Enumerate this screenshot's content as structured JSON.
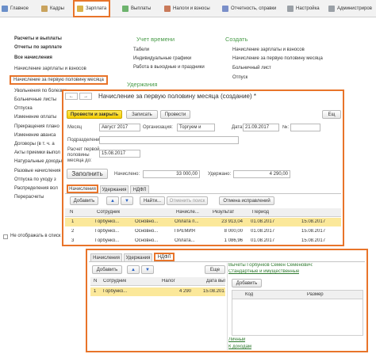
{
  "topbar": {
    "items": [
      "Главное",
      "Кадры",
      "Зарплата",
      "Выплаты",
      "Налоги и взносы",
      "Отчетность, справки",
      "Настройка",
      "Администриров"
    ],
    "icon_colors": [
      "#6a8fc9",
      "#c9a35d",
      "#d9b34a",
      "#6db36d",
      "#c97a5a",
      "#7a8fc9",
      "#9aa0a6",
      "#9aa0a6"
    ]
  },
  "bg": {
    "left_links": [
      "Расчеты и выплаты",
      "Отчеты по зарплате",
      "Все начисления",
      "Начисление зарплаты и взносов",
      "Начисление за первую половину месяца",
      "Увольнения по болезни",
      "Больничные листы",
      "Отпуска",
      "Изменение оплаты",
      "Прекращения плано",
      "Изменение аванса",
      "Договоры (в т. ч. а",
      "Акты приемки выпол",
      "Натуральные доходы",
      "Разовые начисления",
      "Отпуска по уходу з",
      "Распределения вол",
      "Перерасчеты"
    ],
    "accounting_title": "Учет времени",
    "accounting_links": [
      "Табели",
      "Индивидуальные графики",
      "Работа в выходные и праздники"
    ],
    "deductions_title": "Удержания",
    "create_title": "Создать",
    "create_links": [
      "Начисление зарплаты и взносов",
      "Начисление за первую половину месяца",
      "Больничный лист",
      "Отпуск"
    ],
    "checkbox_label": "Не отображать в списк"
  },
  "main_window": {
    "back": "←",
    "forward": "→",
    "title": "Начисление за первую половину месяца (создание) *",
    "btn_post_close": "Провести и закрыть",
    "btn_save": "Записать",
    "btn_post": "Провести",
    "btn_more": "Ещ",
    "month_label": "Месяц",
    "month_value": "Август 2017",
    "org_label": "Организация:",
    "org_value": "Торгуем и",
    "date_label": "Дата:",
    "date_value": "21.09.2017",
    "number_label": "№:",
    "dept_label": "Подразделение:",
    "calc_label_1": "Расчет первой",
    "calc_label_2": "половины",
    "calc_label_3": "месяца до:",
    "calc_value": "15.08.2017",
    "fill_button": "Заполнить",
    "accrued_label": "Начислено:",
    "accrued_value": "33 000,00",
    "withheld_label": "Удержано:",
    "withheld_value": "4 290,00",
    "tabs": [
      "Начисления",
      "Удержания",
      "НДФЛ"
    ],
    "add_button": "Добавить",
    "find_button": "Найти...",
    "cancel_search_button": "Отменить поиск",
    "corrections_button": "Отмена исправлений",
    "columns": [
      "N",
      "Сотрудник",
      "Начисле...",
      "Результат",
      "Период",
      ""
    ],
    "rows": [
      [
        "1",
        "Горбунко...",
        "Основно...",
        "Оплата п...",
        "23 913,04",
        "01.08.2017",
        "15.08.2017"
      ],
      [
        "2",
        "Горбунко...",
        "Основно...",
        "ПРЕМИЯ",
        "8 000,00",
        "01.08.2017",
        "15.08.2017"
      ],
      [
        "3",
        "Горбунко...",
        "Основно...",
        "Оплата...",
        "1 086,96",
        "01.08.2017",
        "15.08.2017"
      ]
    ]
  },
  "ndfl_window": {
    "tabs": [
      "Начисления",
      "Удержания",
      "НДФЛ"
    ],
    "add_button": "Добавить",
    "more_button": "Еще",
    "columns": [
      "N",
      "Сотрудник",
      "Налог",
      "Дата выпла..."
    ],
    "row": [
      "1",
      "Горбунко...",
      "4 290",
      "15.08.2017"
    ],
    "deductions_person": "Вычеты Горбунков Семен Семенович:",
    "deductions_link": "Стандартные и имущественные",
    "right_add_button": "Добавить",
    "right_columns": [
      "Код",
      "Размер"
    ],
    "personal_link": "Личный",
    "income_link": "К доходам"
  }
}
